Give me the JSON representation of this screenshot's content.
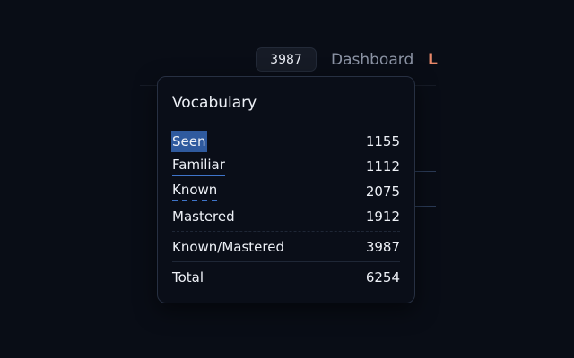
{
  "topbar": {
    "count": "3987",
    "dashboard_label": "Dashboard",
    "user_initial": "L"
  },
  "vocabulary": {
    "title": "Vocabulary",
    "rows": [
      {
        "label": "Seen",
        "value": "1155"
      },
      {
        "label": "Familiar",
        "value": "1112"
      },
      {
        "label": "Known",
        "value": "2075"
      },
      {
        "label": "Mastered",
        "value": "1912"
      }
    ],
    "known_mastered": {
      "label": "Known/Mastered",
      "value": "3987"
    },
    "total": {
      "label": "Total",
      "value": "6254"
    }
  },
  "colors": {
    "background": "#090d16",
    "seen_highlight": "#2f5a9e",
    "underline_accent": "#3f74c9",
    "initial_accent": "#e9896a"
  }
}
